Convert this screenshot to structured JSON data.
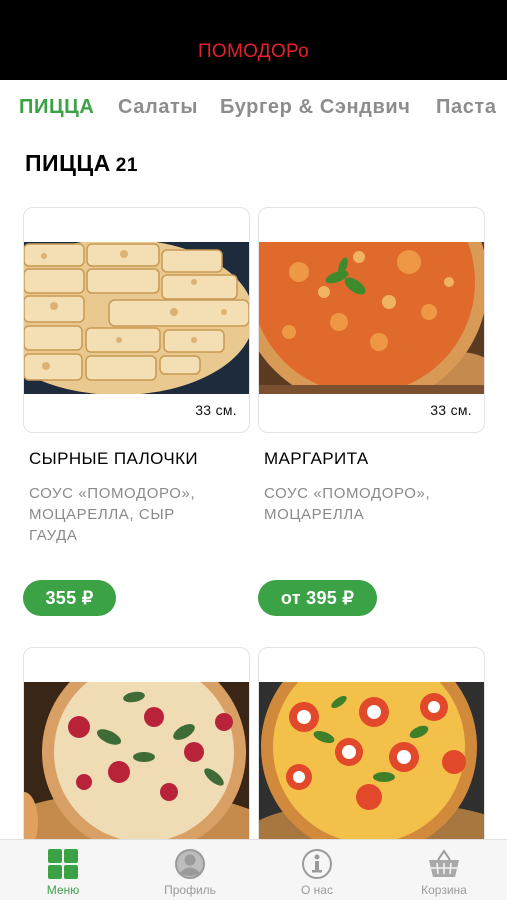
{
  "header": {
    "brand": "ПОМОДОРо"
  },
  "tabs": [
    {
      "label": "ПИЦЦА",
      "active": true
    },
    {
      "label": "Салаты",
      "active": false
    },
    {
      "label": "Бургер & Сэндвич",
      "active": false
    },
    {
      "label": "Паста",
      "active": false
    }
  ],
  "section": {
    "title": "ПИЦЦА",
    "count": "21"
  },
  "products": [
    {
      "name": "СЫРНЫЕ ПАЛОЧКИ",
      "size": "33 см.",
      "desc_lines": [
        "СОУС «ПОМОДОРО»,",
        "МОЦАРЕЛЛА, СЫР",
        "ГАУДА"
      ],
      "price": "355 ₽"
    },
    {
      "name": "МАРГАРИТА",
      "size": "33 см.",
      "desc_lines": [
        "СОУС «ПОМОДОРО»,",
        "МОЦАРЕЛЛА"
      ],
      "price": "от 395 ₽"
    }
  ],
  "bottom_nav": [
    {
      "label": "Меню",
      "icon": "grid-icon",
      "active": true
    },
    {
      "label": "Профиль",
      "icon": "user-icon",
      "active": false
    },
    {
      "label": "О нас",
      "icon": "info-icon",
      "active": false
    },
    {
      "label": "Корзина",
      "icon": "basket-icon",
      "active": false
    }
  ],
  "colors": {
    "accent": "#3ba345",
    "brand": "#e8202a",
    "header_bg": "#000000"
  }
}
